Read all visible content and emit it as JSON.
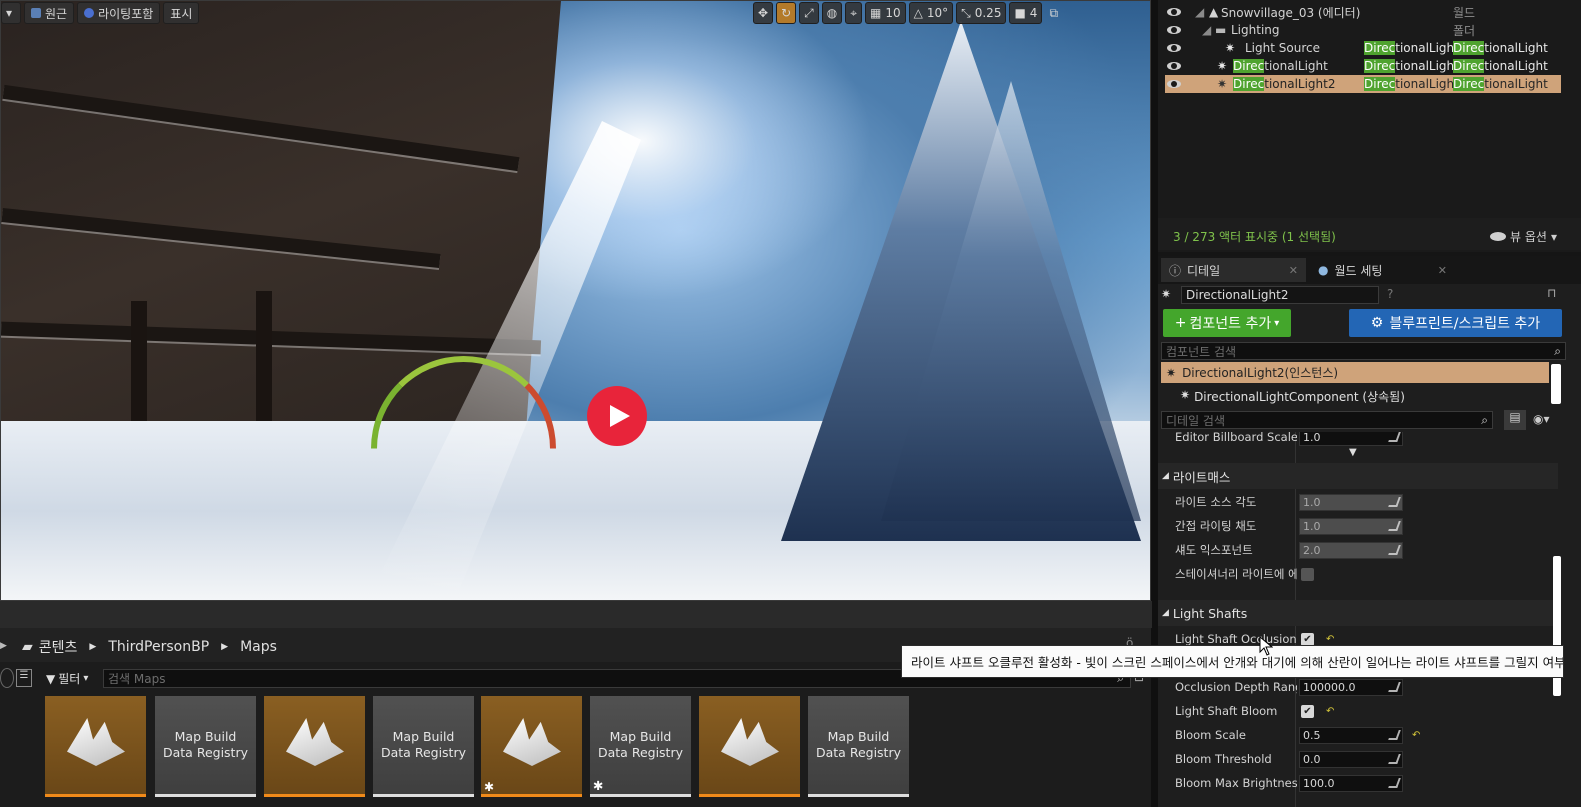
{
  "viewport": {
    "toolbar_left": [
      {
        "label": "원근"
      },
      {
        "label": "라이팅포함"
      },
      {
        "label": "표시"
      }
    ],
    "toolbar_right": {
      "grid_snap": "10",
      "rot_snap": "10°",
      "scale_snap": "0.25",
      "camera_speed": "4"
    }
  },
  "outliner": {
    "rows": [
      {
        "name": "Snowvillage_03 (에디터)",
        "type": "월드",
        "indent": 0
      },
      {
        "name": "Lighting",
        "type": "폴더",
        "indent": 1
      },
      {
        "name": "Light Source",
        "type1_hl": "Direc",
        "type1_rest": "tionalLight",
        "type2_hl": "Direc",
        "type2_rest": "tionalLight"
      },
      {
        "name_hl": "Direc",
        "name_rest": "tionalLight",
        "type1_hl": "Direc",
        "type1_rest": "tionalLight",
        "type2_hl": "Direc",
        "type2_rest": "tionalLight"
      },
      {
        "name_hl": "Direc",
        "name_rest": "tionalLight2",
        "type1_hl": "Direc",
        "type1_rest": "tionalLight",
        "type2_hl": "Direc",
        "type2_rest": "tionalLight"
      }
    ],
    "status": "3 / 273 액터 표시중 (1 선택됨)",
    "view_options": "뷰 옵션"
  },
  "details": {
    "tab_details": "디테일",
    "tab_world": "월드 세팅",
    "name_value": "DirectionalLight2",
    "add_component": "컴포넌트 추가",
    "add_blueprint": "블루프린트/스크립트 추가",
    "component_search_placeholder": "컴포넌트 검색",
    "instance_row": "DirectionalLight2(인스턴스)",
    "component_row": "DirectionalLightComponent (상속됨)",
    "detail_search_placeholder": "디테일 검색",
    "billboard_label": "Editor Billboard Scale",
    "billboard_value": "1.0",
    "lightmass_header": "라이트매스",
    "lightmass_rows": [
      {
        "label": "라이트 소스 각도",
        "value": "1.0"
      },
      {
        "label": "간접 라이팅 채도",
        "value": "1.0"
      },
      {
        "label": "섀도 익스포넌트",
        "value": "2.0"
      }
    ],
    "stationary_label": "스테이셔너리 라이트에 에디",
    "lightshafts_header": "Light Shafts",
    "lightshaft_occlusion_label": "Light Shaft Occlusion",
    "occlusion_depth_label": "Occlusion Depth Range",
    "occlusion_depth_value": "100000.0",
    "lightshaft_bloom_label": "Light Shaft Bloom",
    "bloom_scale_label": "Bloom Scale",
    "bloom_scale_value": "0.5",
    "bloom_threshold_label": "Bloom Threshold",
    "bloom_threshold_value": "0.0",
    "bloom_max_label": "Bloom Max Brightness",
    "bloom_max_value": "100.0"
  },
  "tooltip": "라이트 샤프트 오클루전 활성화 - 빛이 스크린 스페이스에서 안개와 대기에 의해 산란이 일어나는 라이트 샤프트를 그릴지 여부입니다.",
  "content": {
    "breadcrumb": [
      "콘텐츠",
      "ThirdPersonBP",
      "Maps"
    ],
    "filter_label": "필터",
    "search_placeholder": "검색 Maps",
    "tiles": [
      {
        "kind": "map"
      },
      {
        "kind": "reg",
        "label": "Map Build Data Registry"
      },
      {
        "kind": "map"
      },
      {
        "kind": "reg",
        "label": "Map Build Data Registry"
      },
      {
        "kind": "map"
      },
      {
        "kind": "reg",
        "label": "Map Build Data Registry"
      },
      {
        "kind": "map"
      },
      {
        "kind": "reg",
        "label": "Map Build Data Registry"
      }
    ]
  },
  "colors": {
    "accent_orange": "#b37a2a",
    "selection": "#cfa37a",
    "filter_highlight": "#4fa32f",
    "add_component_green": "#44a62c",
    "blueprint_blue": "#2366b5",
    "play_red": "#e8243a"
  }
}
